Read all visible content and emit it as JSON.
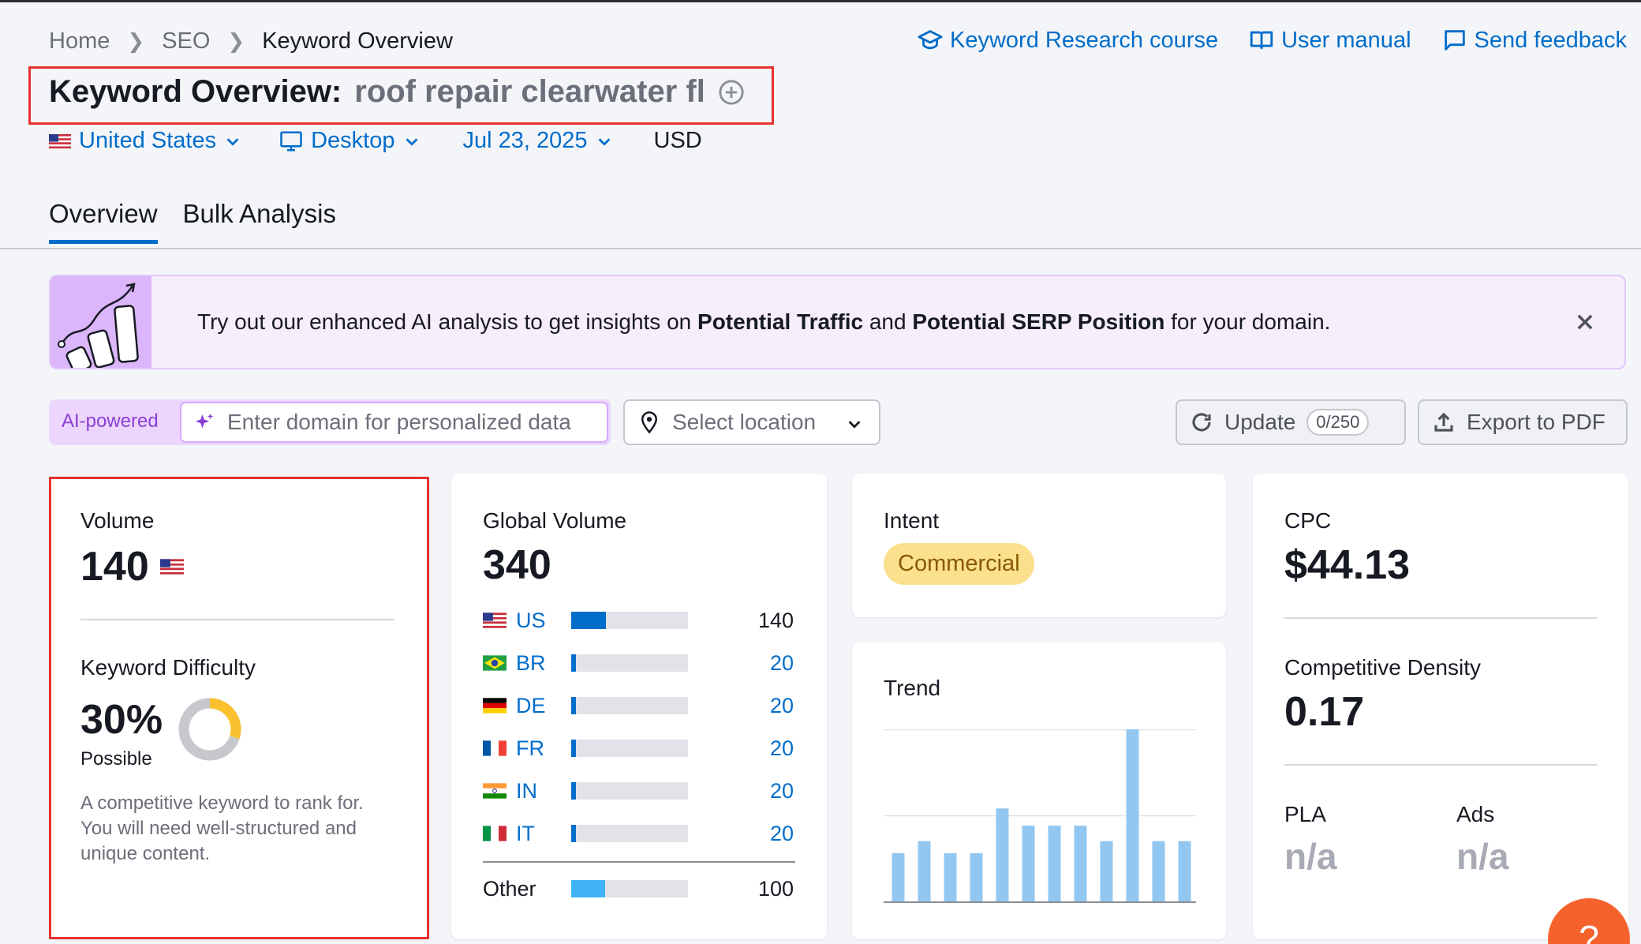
{
  "breadcrumb": {
    "items": [
      "Home",
      "SEO"
    ],
    "current": "Keyword Overview"
  },
  "toplinks": {
    "course": "Keyword Research course",
    "manual": "User manual",
    "feedback": "Send feedback"
  },
  "title": {
    "prefix": "Keyword Overview:",
    "keyword": "roof repair clearwater fl"
  },
  "filters": {
    "country": "United States",
    "device": "Desktop",
    "date": "Jul 23, 2025",
    "currency": "USD"
  },
  "tabs": [
    "Overview",
    "Bulk Analysis"
  ],
  "banner": {
    "text_1": "Try out our enhanced AI analysis to get insights on ",
    "bold_1": "Potential Traffic",
    "text_2": " and ",
    "bold_2": "Potential SERP Position",
    "text_3": " for your domain."
  },
  "search": {
    "ai_label": "AI-powered",
    "domain_placeholder": "Enter domain for personalized data",
    "location_placeholder": "Select location",
    "update_label": "Update",
    "update_counter": "0/250",
    "export_label": "Export to PDF"
  },
  "volume": {
    "label": "Volume",
    "value": "140",
    "kd_label": "Keyword Difficulty",
    "kd_value": "30%",
    "kd_percent": 30,
    "kd_status": "Possible",
    "kd_description": "A competitive keyword to rank for. You will need well-structured and unique content."
  },
  "global_volume": {
    "label": "Global Volume",
    "value": "340",
    "rows": [
      {
        "code": "US",
        "value": "140",
        "share": 0.3
      },
      {
        "code": "BR",
        "value": "20",
        "share": 0.04
      },
      {
        "code": "DE",
        "value": "20",
        "share": 0.04
      },
      {
        "code": "FR",
        "value": "20",
        "share": 0.04
      },
      {
        "code": "IN",
        "value": "20",
        "share": 0.04
      },
      {
        "code": "IT",
        "value": "20",
        "share": 0.04
      }
    ],
    "other_label": "Other",
    "other_value": "100",
    "other_share": 0.29
  },
  "intent": {
    "label": "Intent",
    "value": "Commercial"
  },
  "trend": {
    "label": "Trend",
    "values": [
      0.28,
      0.35,
      0.28,
      0.28,
      0.54,
      0.44,
      0.44,
      0.44,
      0.35,
      1.0,
      0.35,
      0.35
    ]
  },
  "cpc": {
    "label": "CPC",
    "value": "$44.13",
    "density_label": "Competitive Density",
    "density_value": "0.17",
    "pla_label": "PLA",
    "pla_value": "n/a",
    "ads_label": "Ads",
    "ads_value": "n/a"
  },
  "help": {
    "label": "?"
  },
  "colors": {
    "accent": "#006dca",
    "highlight": "#e8312f",
    "trend_bar": "#92c7f1",
    "kd_gauge": "#fbc02d"
  }
}
